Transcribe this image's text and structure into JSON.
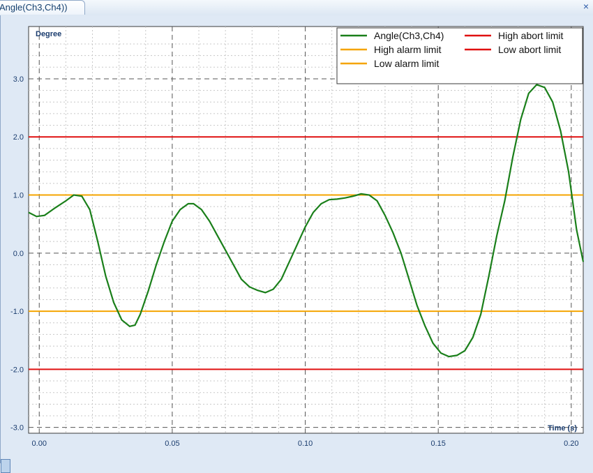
{
  "tab": {
    "title": "Angle(Ch3,Ch4))",
    "close_glyph": "×"
  },
  "colors": {
    "angle": "#1a7f1a",
    "alarm": "#f5a400",
    "abort": "#e01010",
    "axis_text": "#1a3c6e"
  },
  "chart_data": {
    "type": "line",
    "ylabel": "Degree",
    "xlabel": "Time (s)",
    "xlim": [
      -0.004,
      0.2045
    ],
    "ylim": [
      -3.1,
      3.9
    ],
    "x_ticks": [
      0.0,
      0.05,
      0.1,
      0.15,
      0.2
    ],
    "x_tick_labels": [
      "0.00",
      "0.05",
      "0.10",
      "0.15",
      "0.20"
    ],
    "y_ticks": [
      3.0,
      2.0,
      1.0,
      0.0,
      -1.0,
      -2.0,
      -3.0
    ],
    "y_tick_labels": [
      "3.0",
      "2.0",
      "1.0",
      "0.0",
      "-1.0",
      "-2.0",
      "-3.0"
    ],
    "grid": true,
    "legend_position": "top-right",
    "series": [
      {
        "name": "Angle(Ch3,Ch4)",
        "color_key": "angle",
        "x": [
          -0.004,
          -0.001,
          0.002,
          0.006,
          0.01,
          0.013,
          0.016,
          0.019,
          0.022,
          0.025,
          0.028,
          0.031,
          0.034,
          0.036,
          0.038,
          0.041,
          0.044,
          0.047,
          0.05,
          0.053,
          0.056,
          0.058,
          0.061,
          0.064,
          0.067,
          0.07,
          0.073,
          0.076,
          0.079,
          0.082,
          0.085,
          0.088,
          0.091,
          0.094,
          0.097,
          0.1,
          0.103,
          0.106,
          0.109,
          0.112,
          0.115,
          0.118,
          0.121,
          0.124,
          0.127,
          0.13,
          0.133,
          0.136,
          0.139,
          0.142,
          0.145,
          0.148,
          0.151,
          0.154,
          0.157,
          0.16,
          0.163,
          0.166,
          0.169,
          0.172,
          0.175,
          0.178,
          0.181,
          0.184,
          0.187,
          0.19,
          0.193,
          0.196,
          0.199,
          0.202,
          0.2045
        ],
        "values": [
          0.7,
          0.63,
          0.65,
          0.78,
          0.9,
          1.0,
          0.98,
          0.75,
          0.2,
          -0.4,
          -0.85,
          -1.15,
          -1.26,
          -1.24,
          -1.05,
          -0.65,
          -0.2,
          0.2,
          0.55,
          0.75,
          0.85,
          0.85,
          0.75,
          0.55,
          0.3,
          0.05,
          -0.2,
          -0.45,
          -0.58,
          -0.64,
          -0.68,
          -0.62,
          -0.45,
          -0.15,
          0.15,
          0.45,
          0.7,
          0.85,
          0.92,
          0.93,
          0.95,
          0.98,
          1.02,
          1.0,
          0.9,
          0.65,
          0.35,
          0.0,
          -0.45,
          -0.9,
          -1.25,
          -1.55,
          -1.72,
          -1.78,
          -1.76,
          -1.68,
          -1.45,
          -1.05,
          -0.4,
          0.3,
          0.9,
          1.65,
          2.3,
          2.75,
          2.9,
          2.85,
          2.6,
          2.1,
          1.4,
          0.4,
          -0.15
        ]
      },
      {
        "name": "High alarm limit",
        "color_key": "alarm",
        "constant": 1.0
      },
      {
        "name": "Low alarm limit",
        "color_key": "alarm",
        "constant": -1.0
      },
      {
        "name": "High abort limit",
        "color_key": "abort",
        "constant": 2.0
      },
      {
        "name": "Low abort limit",
        "color_key": "abort",
        "constant": -2.0
      }
    ]
  }
}
